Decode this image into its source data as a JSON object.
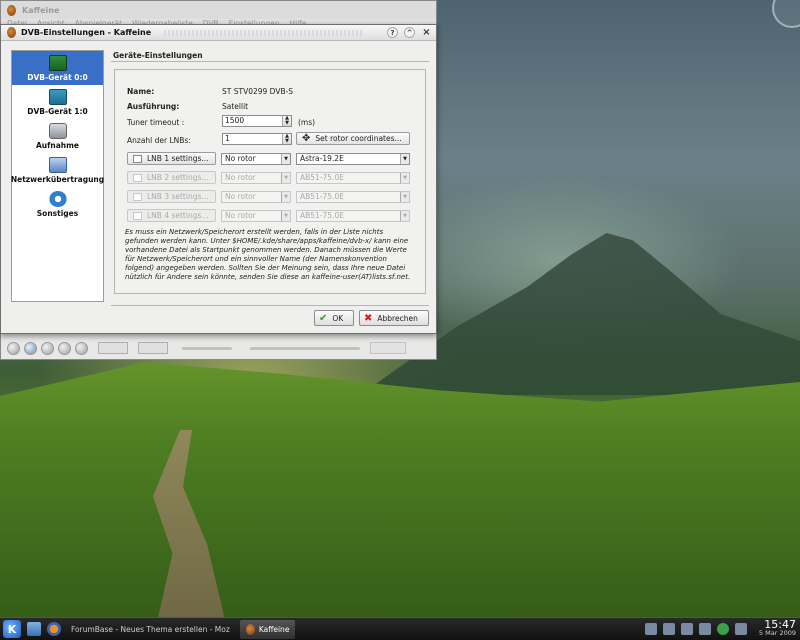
{
  "main_window": {
    "title": "Kaffeine",
    "menu": [
      "Datei",
      "Ansicht",
      "Abspielgerät",
      "Wiedergabeliste",
      "DVB",
      "Einstellungen",
      "Hilfe"
    ]
  },
  "dialog": {
    "title": "DVB-Einstellungen - Kaffeine",
    "help_button": "?",
    "shade_button": "^",
    "close_button": "×",
    "sidebar": [
      {
        "label": "DVB-Gerät 0:0",
        "active": true
      },
      {
        "label": "DVB-Gerät 1:0",
        "active": false
      },
      {
        "label": "Aufnahme",
        "active": false
      },
      {
        "label": "Netzwerkübertragung",
        "active": false
      },
      {
        "label": "Sonstiges",
        "active": false
      }
    ],
    "section_title": "Geräte-Einstellungen",
    "name_label": "Name:",
    "name_value": "ST STV0299 DVB-S",
    "type_label": "Ausführung:",
    "type_value": "Satellit",
    "tuner_label": "Tuner timeout :",
    "tuner_value": "1500",
    "tuner_unit": "(ms)",
    "lnb_count_label": "Anzahl der LNBs:",
    "lnb_count_value": "1",
    "rotor_button": "Set rotor coordinates...",
    "lnbs": [
      {
        "button": "LNB 1 settings...",
        "rotor": "No rotor",
        "source": "Astra-19.2E",
        "enabled": true
      },
      {
        "button": "LNB 2 settings...",
        "rotor": "No rotor",
        "source": "AB51-75.0E",
        "enabled": false
      },
      {
        "button": "LNB 3 settings...",
        "rotor": "No rotor",
        "source": "AB51-75.0E",
        "enabled": false
      },
      {
        "button": "LNB 4 settings...",
        "rotor": "No rotor",
        "source": "AB51-75.0E",
        "enabled": false
      }
    ],
    "info_text": "Es muss ein Netzwerk/Speicherort erstellt werden, falls in der Liste nichts gefunden werden kann. Unter $HOME/.kde/share/apps/kaffeine/dvb-x/ kann eine vorhandene Datei als Startpunkt genommen werden. Danach müssen die Werte für Netzwerk/Speicherort und ein sinnvoller Name (der Namenskonvention folgend) angegeben werden. Sollten Sie der Meinung sein, dass Ihre neue Datei nützlich für Andere sein könnte, senden Sie diese an kaffeine-user(AT)lists.sf.net.",
    "ok_button": "OK",
    "cancel_button": "Abbrechen"
  },
  "taskbar": {
    "tasks": [
      {
        "label": "ForumBase - Neues Thema erstellen - Moz",
        "active": false
      },
      {
        "label": "Kaffeine",
        "active": true
      }
    ],
    "clock_time": "15:47",
    "clock_date": "5 Mar 2009"
  }
}
